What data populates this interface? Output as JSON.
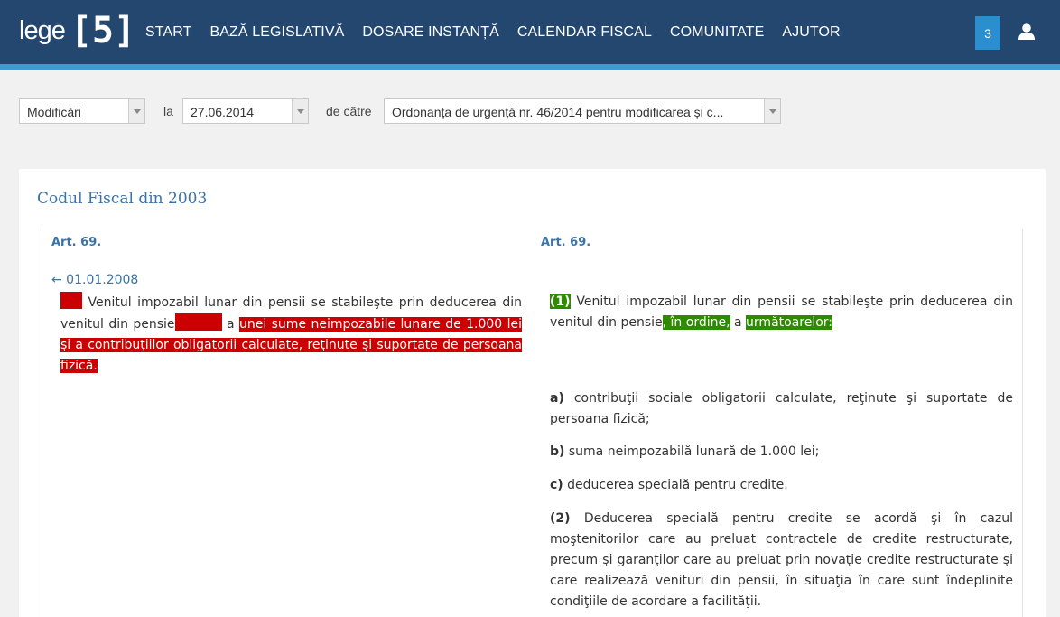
{
  "header": {
    "logo_word": "lege",
    "logo_mark": "[5]",
    "nav": [
      "START",
      "BAZĂ LEGISLATIVĂ",
      "DOSARE INSTANȚĂ",
      "CALENDAR FISCAL",
      "COMUNITATE",
      "AJUTOR"
    ],
    "notification_count": "3",
    "user_icon": "user-icon",
    "colors": {
      "bar": "#24476f",
      "accent": "#3e9ad5",
      "badge": "#2b8fcf"
    }
  },
  "filters": {
    "mode_value": "Modificări",
    "date_label": "la",
    "date_value": "27.06.2014",
    "by_label": "de către",
    "act_value": "Ordonanța de urgență nr. 46/2014 pentru modificarea și c..."
  },
  "document": {
    "title": "Codul Fiscal din 2003",
    "left": {
      "article": "Art. 69.",
      "date_link": "← 01.01.2008",
      "p1": "Venitul impozabil lunar din pensii se stabileşte prin deducerea din venitul din pensie",
      "p1_a": "a",
      "p1_del": "unei sume neimpozabile lunare de 1.000 lei şi a contribuţiilor obligatorii calculate, reţinute şi suportate de persoana fizică."
    },
    "right": {
      "article": "Art. 69.",
      "p1_num": "(1)",
      "p1_text": "Venitul impozabil lunar din pensii se stabileşte prin deducerea din venitul din pensie",
      "p1_ins1": ", în ordine,",
      "p1_a": "a",
      "p1_ins2": "următoarelor:",
      "a_num": "a)",
      "a_text": "contribuţii sociale obligatorii calculate, reţinute şi suportate de persoana fizică;",
      "b_num": "b)",
      "b_text": "suma neimpozabilă lunară de 1.000 lei;",
      "c_num": "c)",
      "c_text": "deducerea specială pentru credite.",
      "p2_num": "(2)",
      "p2_text": "Deducerea specială pentru credite se acordă şi în cazul moştenitorilor care au preluat contractele de credite restructurate, precum şi garanţilor care au preluat prin novaţie credite restructurate şi care realizează venituri din pensii, în situaţia în care sunt îndeplinite condiţiile de acordare a facilităţii."
    },
    "colors": {
      "deleted": "#cc0000",
      "inserted": "#2e8b00",
      "link": "#3b73a6"
    }
  }
}
